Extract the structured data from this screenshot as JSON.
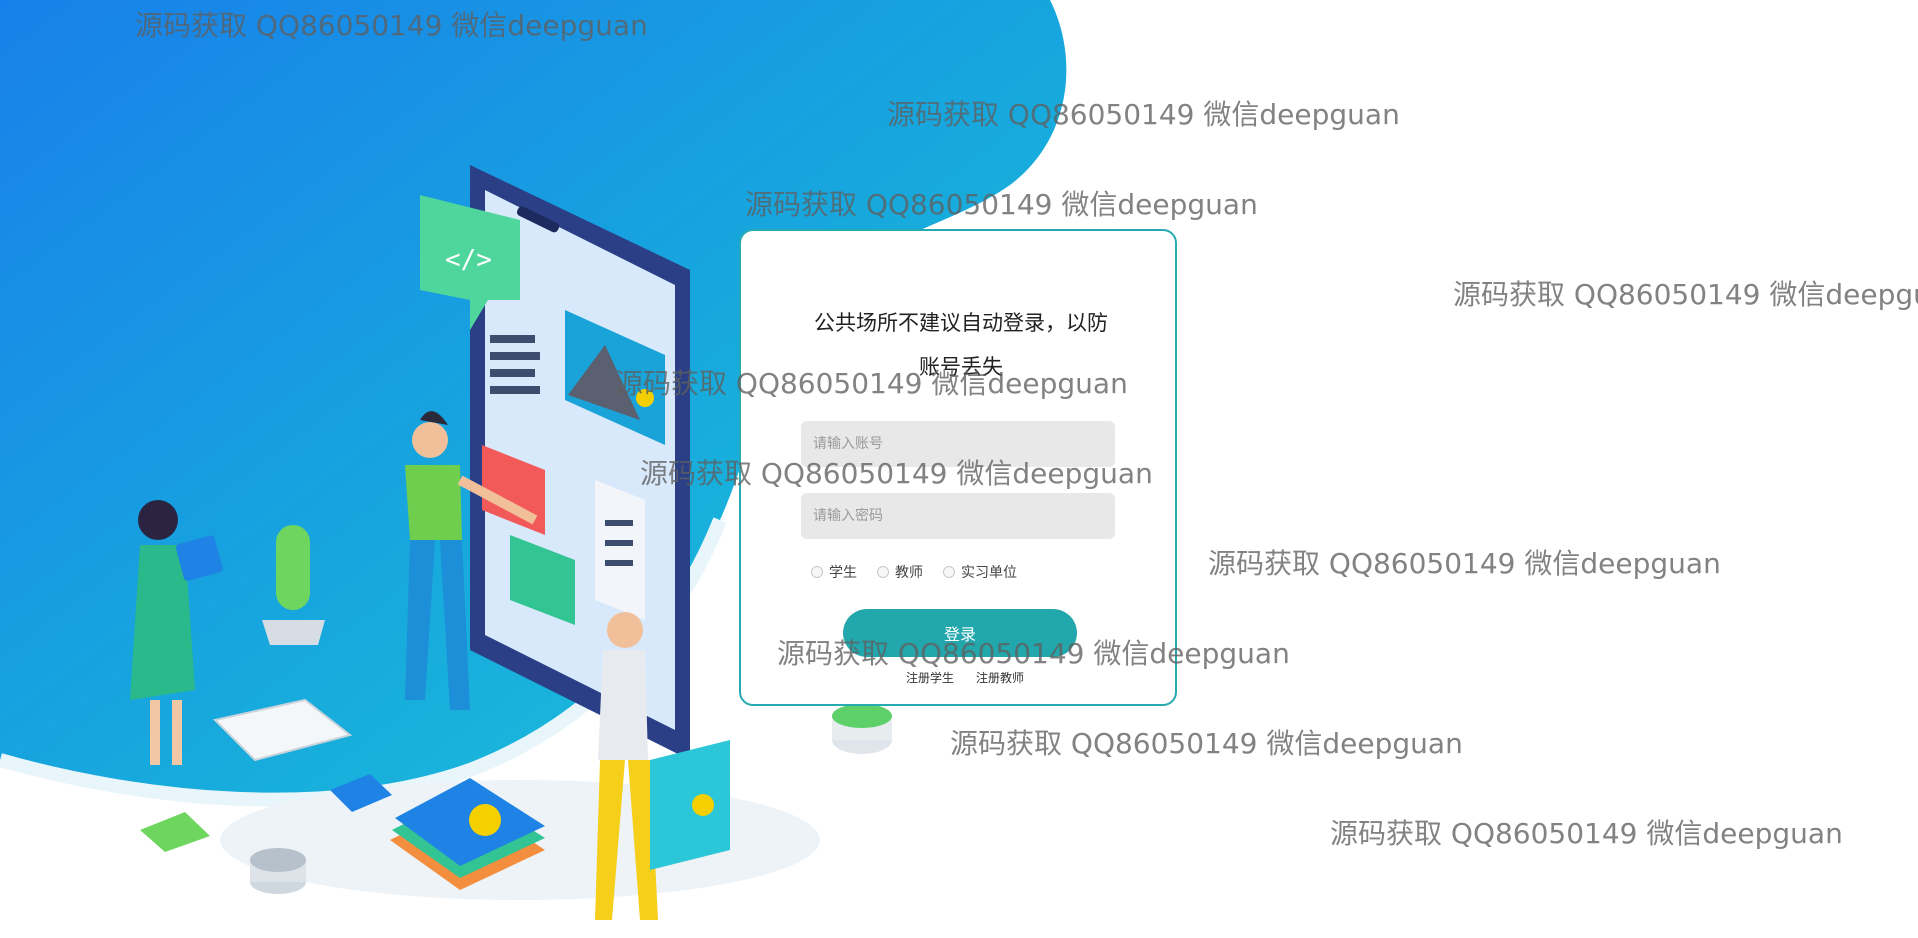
{
  "login": {
    "notice": "公共场所不建议自动登录，以防账号丢失",
    "account_placeholder": "请输入账号",
    "password_placeholder": "请输入密码",
    "roles": [
      "学生",
      "教师",
      "实习单位"
    ],
    "login_label": "登录",
    "register_student": "注册学生",
    "register_teacher": "注册教师"
  },
  "watermark_text": "源码获取 QQ86050149 微信deepguan",
  "colors": {
    "accent": "#22a7ad",
    "blob_start": "#1b7fe8",
    "blob_end": "#1cc6d6"
  }
}
